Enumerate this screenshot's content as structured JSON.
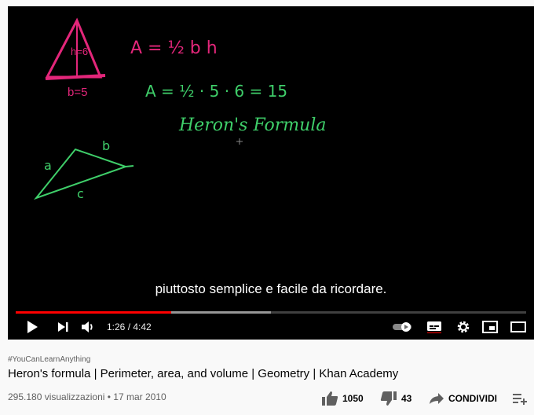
{
  "video": {
    "subtitle": "piuttosto semplice e facile da ricordare.",
    "time_display": "1:26 / 4:42",
    "progress": 0.305,
    "buffered": 0.5,
    "board": {
      "triangle_height": "h=6",
      "triangle_base": "b=5",
      "area_formula": "A = ½ b h",
      "area_calc": "A = ½ · 5 · 6  = 15",
      "heading": "Heron's Formula",
      "side_a": "a",
      "side_b": "b",
      "side_c": "c"
    }
  },
  "info": {
    "hashtag": "#YouCanLearnAnything",
    "title": "Heron's formula | Perimeter, area, and volume | Geometry | Khan Academy",
    "views": "295.180 visualizzazioni • 17 mar 2010",
    "likes": "1050",
    "dislikes": "43",
    "share_label": "CONDIVIDI"
  },
  "colors": {
    "progress": "#ff0000",
    "chalk_pink": "#e3267a",
    "chalk_green": "#3fcf6a"
  }
}
